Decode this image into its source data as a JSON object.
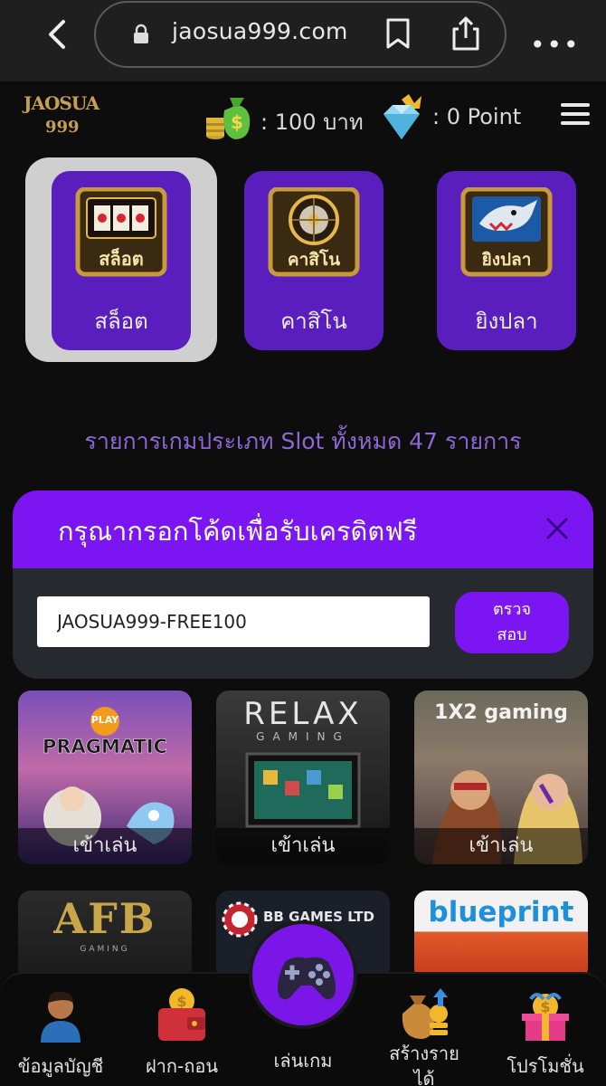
{
  "browser": {
    "url": "jaosua999.com"
  },
  "header": {
    "logo_top": "JAOSUA",
    "logo_bottom": "999",
    "credit": ": 100 บาท",
    "points": ": 0 Point"
  },
  "categories": [
    {
      "label": "สล็อต",
      "emblem_text": "สล็อต",
      "selected": true
    },
    {
      "label": "คาสิโน",
      "emblem_text": "คาสิโน",
      "selected": false
    },
    {
      "label": "ยิงปลา",
      "emblem_text": "ยิงปลา",
      "selected": false
    }
  ],
  "summary": "รายการเกมประเภท Slot ทั้งหมด 47 รายการ",
  "modal": {
    "title": "กรุณากรอกโค้ดเพื่อรับเครดิตฟรี",
    "code_value": "JAOSUA999-FREE100",
    "check_line1": "ตรวจ",
    "check_line2": "สอบ"
  },
  "providers": [
    {
      "brand": "PRAGMATIC",
      "sub": "PLAY",
      "play": "เข้าเล่น"
    },
    {
      "brand": "RELAX",
      "sub": "GAMING",
      "play": "เข้าเล่น"
    },
    {
      "brand": "1X2 gaming",
      "sub": "",
      "play": "เข้าเล่น"
    },
    {
      "brand": "AFB",
      "sub": "GAMING",
      "play": ""
    },
    {
      "brand": "BB GAMES LTD",
      "sub": "",
      "play": ""
    },
    {
      "brand": "blueprint",
      "sub": "",
      "play": ""
    }
  ],
  "bottom_nav": [
    {
      "label": "ข้อมูลบัญชี",
      "icon": "account-icon"
    },
    {
      "label": "ฝาก-ถอน",
      "icon": "wallet-icon"
    },
    {
      "label": "เล่นเกม",
      "icon": "gamepad-icon"
    },
    {
      "label": "สร้างราย",
      "label2": "ได้",
      "icon": "earn-money-icon"
    },
    {
      "label": "โปรโมชั่น",
      "icon": "gift-icon"
    }
  ],
  "colors": {
    "accent": "#7b16f3",
    "tile": "#5a1ebf",
    "summary_text": "#8d67d4",
    "background": "#0d0d0d"
  }
}
